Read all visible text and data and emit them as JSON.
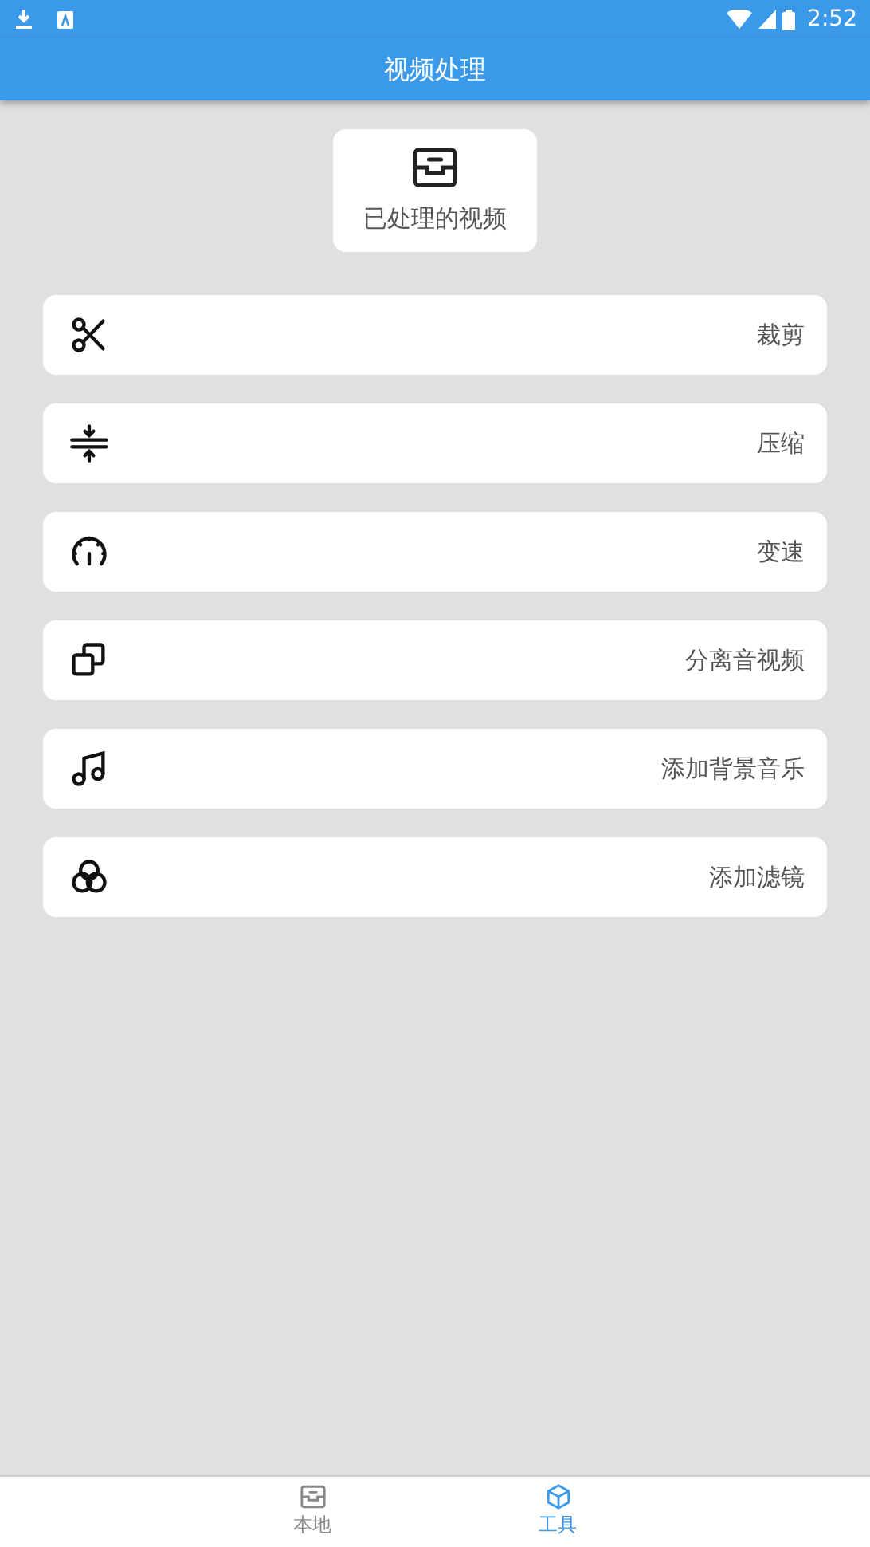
{
  "status_bar": {
    "time": "2:52"
  },
  "app_bar": {
    "title": "视频处理"
  },
  "processed_button": {
    "label": "已处理的视频"
  },
  "tools": [
    {
      "kind": "cut",
      "label": "裁剪"
    },
    {
      "kind": "compress",
      "label": "压缩"
    },
    {
      "kind": "speed",
      "label": "变速"
    },
    {
      "kind": "separate",
      "label": "分离音视频"
    },
    {
      "kind": "music",
      "label": "添加背景音乐"
    },
    {
      "kind": "filter",
      "label": "添加滤镜"
    }
  ],
  "bottom_nav": [
    {
      "kind": "local",
      "label": "本地",
      "selected": false
    },
    {
      "kind": "tools",
      "label": "工具",
      "selected": true
    }
  ]
}
